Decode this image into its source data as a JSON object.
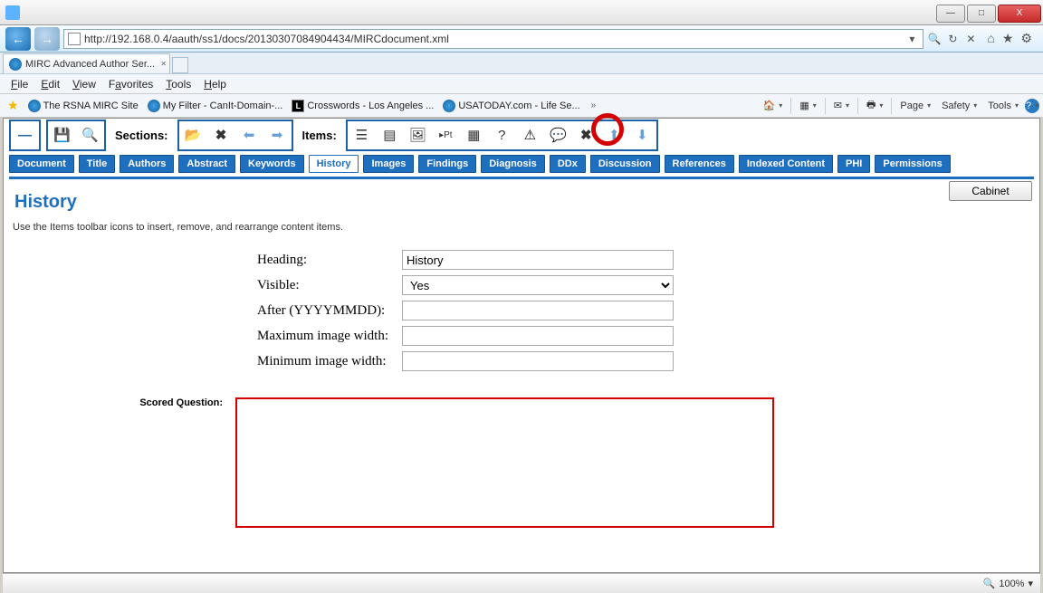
{
  "window": {
    "title": ""
  },
  "winbtns": {
    "min": "—",
    "max": "□",
    "close": "X"
  },
  "nav": {
    "back": "←",
    "fwd": "→",
    "url": "http://192.168.0.4/aauth/ss1/docs/20130307084904434/MIRCdocument.xml"
  },
  "tab": {
    "label": "MIRC Advanced Author Ser..."
  },
  "menu": [
    "File",
    "Edit",
    "View",
    "Favorites",
    "Tools",
    "Help"
  ],
  "menuKeys": [
    "F",
    "E",
    "V",
    "a",
    "T",
    "H"
  ],
  "favlinks": [
    {
      "label": "The RSNA MIRC Site",
      "ico": "ie"
    },
    {
      "label": "My Filter - CanIt-Domain-...",
      "ico": "ie"
    },
    {
      "label": "Crosswords - Los Angeles ...",
      "ico": "la"
    },
    {
      "label": "USATODAY.com - Life Se...",
      "ico": "ie"
    }
  ],
  "rmenu": [
    "Page",
    "Safety",
    "Tools"
  ],
  "toolbar": {
    "sections_label": "Sections:",
    "items_label": "Items:"
  },
  "sectiontabs": [
    "Document",
    "Title",
    "Authors",
    "Abstract",
    "Keywords",
    "History",
    "Images",
    "Findings",
    "Diagnosis",
    "DDx",
    "Discussion",
    "References",
    "Indexed Content",
    "PHI",
    "Permissions"
  ],
  "activeTab": "History",
  "page": {
    "title": "History",
    "hint": "Use the Items toolbar icons to insert, remove, and rearrange content items.",
    "cabinet": "Cabinet",
    "fields": {
      "heading_label": "Heading:",
      "heading_value": "History",
      "visible_label": "Visible:",
      "visible_value": "Yes",
      "after_label": "After (YYYYMMDD):",
      "after_value": "",
      "maxw_label": "Maximum image width:",
      "maxw_value": "",
      "minw_label": "Minimum image width:",
      "minw_value": ""
    },
    "sq_label": "Scored Question:",
    "sq_value": ""
  },
  "status": {
    "zoom": "100%"
  },
  "chevrons": "»"
}
